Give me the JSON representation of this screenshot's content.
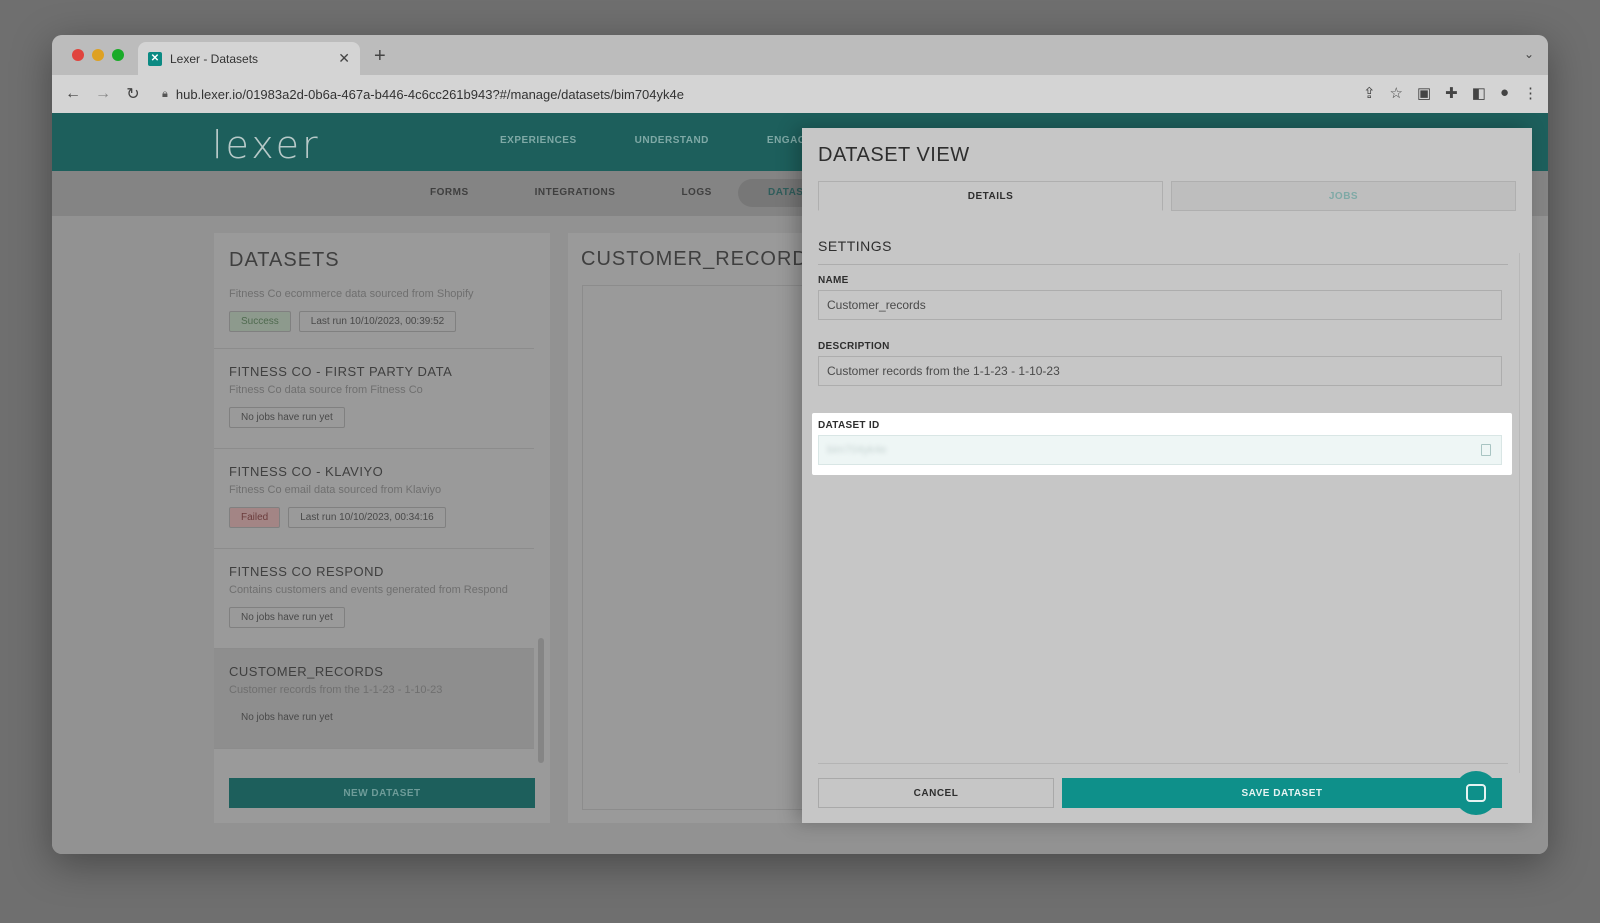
{
  "browser": {
    "tab_title": "Lexer - Datasets",
    "url": "hub.lexer.io/01983a2d-0b6a-467a-b446-4c6cc261b943?#/manage/datasets/bim704yk4e"
  },
  "app": {
    "logo": "lexer",
    "topnav": [
      "EXPERIENCES",
      "UNDERSTAND",
      "ENGAGE"
    ],
    "subnav": [
      "FORMS",
      "INTEGRATIONS",
      "LOGS"
    ],
    "subnav_active": "DATAS"
  },
  "datasets_panel": {
    "title": "DATASETS",
    "items": [
      {
        "name": "",
        "description": "Fitness Co ecommerce data sourced from Shopify",
        "status": "Success",
        "last_run": "Last run 10/10/2023, 00:39:52"
      },
      {
        "name": "FITNESS CO - FIRST PARTY DATA",
        "description": "Fitness Co data source from Fitness Co",
        "status": "No jobs have run yet"
      },
      {
        "name": "FITNESS CO - KLAVIYO",
        "description": "Fitness Co email data sourced from Klaviyo",
        "status": "Failed",
        "last_run": "Last run 10/10/2023, 00:34:16"
      },
      {
        "name": "FITNESS CO RESPOND",
        "description": "Contains customers and events generated from Respond",
        "status": "No jobs have run yet"
      },
      {
        "name": "CUSTOMER_RECORDS",
        "description": "Customer records from the 1-1-23 - 1-10-23",
        "status": "No jobs have run yet"
      }
    ],
    "new_button": "NEW DATASET"
  },
  "detail_panel": {
    "title": "CUSTOMER_RECORDS"
  },
  "drawer": {
    "title": "DATASET VIEW",
    "tabs": [
      "DETAILS",
      "JOBS"
    ],
    "section": "SETTINGS",
    "name_label": "NAME",
    "name_value": "Customer_records",
    "description_label": "DESCRIPTION",
    "description_value": "Customer records from the 1-1-23 - 1-10-23",
    "dataset_id_label": "DATASET ID",
    "dataset_id_value": "bim704yk4e",
    "cancel": "CANCEL",
    "save": "SAVE DATASET"
  },
  "colors": {
    "brand_teal": "#0e908a",
    "nav_dark_teal": "#1d5f5c"
  }
}
